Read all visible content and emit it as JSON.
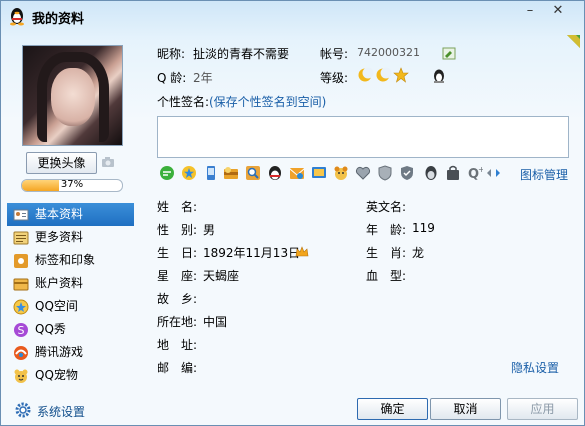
{
  "window": {
    "title": "我的资料",
    "minimize": "–",
    "close": "✕"
  },
  "avatar": {
    "change_label": "更换头像",
    "completion_percent": 37,
    "completion_text": "37%"
  },
  "nav": {
    "items": [
      {
        "label": "基本资料",
        "icon": "profile-card-icon"
      },
      {
        "label": "更多资料",
        "icon": "more-info-icon"
      },
      {
        "label": "标签和印象",
        "icon": "tag-icon"
      },
      {
        "label": "账户资料",
        "icon": "account-icon"
      },
      {
        "label": "QQ空间",
        "icon": "qzone-icon"
      },
      {
        "label": "QQ秀",
        "icon": "qqshow-icon"
      },
      {
        "label": "腾讯游戏",
        "icon": "game-icon"
      },
      {
        "label": "QQ宠物",
        "icon": "pet-icon"
      }
    ],
    "active_index": 0
  },
  "header": {
    "nickname_label": "昵称:",
    "nickname": "扯淡的青春不需要",
    "account_label": "帐号:",
    "account": "742000321",
    "age_label": "Q 龄:",
    "age": "2年",
    "level_label": "等级:"
  },
  "signature": {
    "label": "个性签名:",
    "save_link": "(保存个性签名到空间)",
    "value": ""
  },
  "icons": {
    "manage_label": "图标管理"
  },
  "fields": {
    "name_label": "姓　名:",
    "name_value": "",
    "english_name_label": "英文名:",
    "english_name_value": "",
    "gender_label": "性　别:",
    "gender_value": "男",
    "age_label": "年　龄:",
    "age_value": "119",
    "birthday_label": "生　日:",
    "birthday_value": "1892年11月13日",
    "zodiac_label": "生　肖:",
    "zodiac_value": "龙",
    "constellation_label": "星　座:",
    "constellation_value": "天蝎座",
    "blood_label": "血　型:",
    "blood_value": "",
    "hometown_label": "故　乡:",
    "hometown_value": "",
    "location_label": "所在地:",
    "location_value": "中国",
    "address_label": "地　址:",
    "address_value": "",
    "postcode_label": "邮　编:",
    "postcode_value": ""
  },
  "privacy_link": "隐私设置",
  "footer": {
    "system_settings": "系统设置",
    "ok": "确定",
    "cancel": "取消",
    "apply": "应用"
  },
  "colors": {
    "active_nav": "#2a7fd0",
    "link": "#1a5fa8",
    "progress": "#f5a623"
  }
}
